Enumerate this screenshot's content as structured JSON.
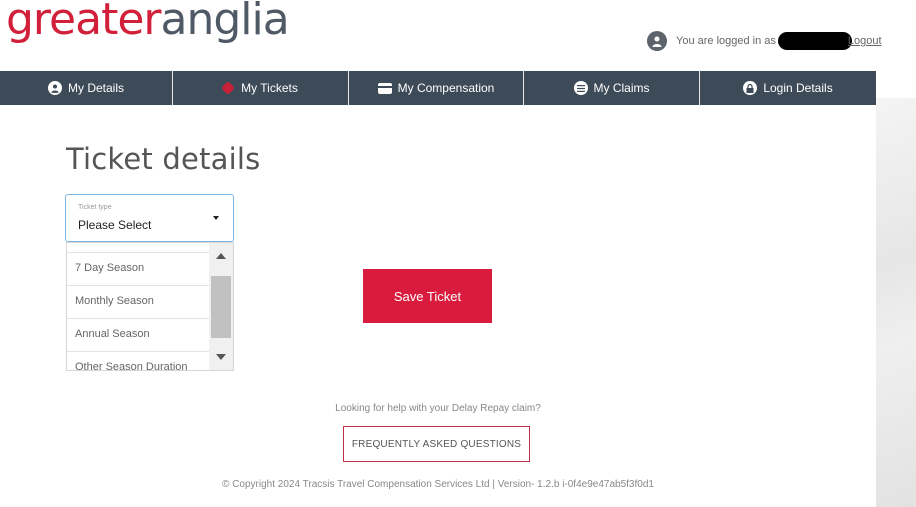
{
  "brand": {
    "logo_part1": "greater",
    "logo_part2": "anglia",
    "primary_color": "#d3203a",
    "secondary_color": "#505a66"
  },
  "header": {
    "logged_in_text": "You are logged in as",
    "logout_label": "Logout"
  },
  "nav": {
    "items": [
      {
        "label": "My Details",
        "icon": "user-icon"
      },
      {
        "label": "My Tickets",
        "icon": "ticket-icon"
      },
      {
        "label": "My Compensation",
        "icon": "card-icon"
      },
      {
        "label": "My Claims",
        "icon": "list-icon"
      },
      {
        "label": "Login Details",
        "icon": "lock-icon"
      }
    ],
    "background": "#3d4a57"
  },
  "main": {
    "title": "Ticket details",
    "ticket_type": {
      "label": "Ticket type",
      "value": "Please Select",
      "options": [
        "7 Day Season",
        "Monthly Season",
        "Annual Season",
        "Other Season Duration"
      ]
    },
    "save_button": "Save Ticket",
    "save_button_color": "#d91c3e"
  },
  "help": {
    "text": "Looking for help with your Delay Repay claim?",
    "faq_button": "FREQUENTLY ASKED QUESTIONS"
  },
  "footer": {
    "copyright": "© Copyright 2024 Tracsis Travel Compensation Services Ltd | Version- 1.2.b i-0f4e9e47ab5f3f0d1"
  }
}
